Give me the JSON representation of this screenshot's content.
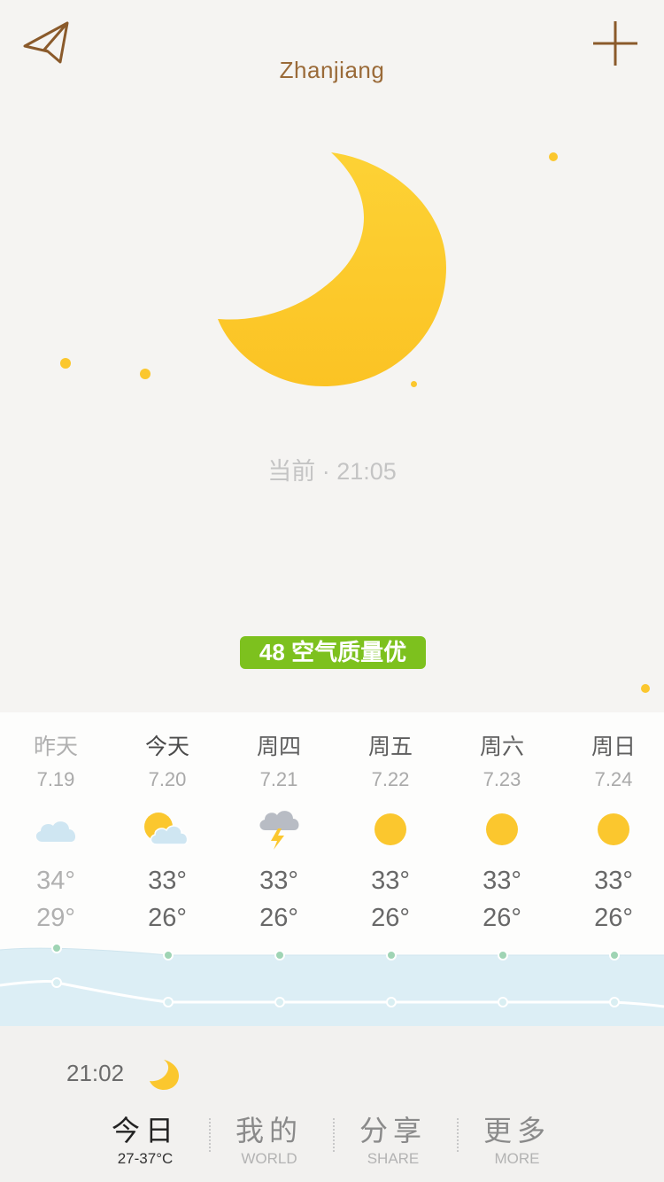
{
  "header": {
    "city": "Zhanjiang",
    "share_icon": "paper-plane-icon",
    "add_icon": "plus-icon"
  },
  "current": {
    "icon": "moon-icon",
    "time_label": "当前 · 21:05"
  },
  "air_quality": {
    "label": "48 空气质量优",
    "color": "#7dc11e"
  },
  "forecast": [
    {
      "day": "昨天",
      "date": "7.19",
      "icon": "cloud-icon",
      "high": "34°",
      "low": "29°"
    },
    {
      "day": "今天",
      "date": "7.20",
      "icon": "partly-cloudy-icon",
      "high": "33°",
      "low": "26°"
    },
    {
      "day": "周四",
      "date": "7.21",
      "icon": "thunderstorm-icon",
      "high": "33°",
      "low": "26°"
    },
    {
      "day": "周五",
      "date": "7.22",
      "icon": "sun-icon",
      "high": "33°",
      "low": "26°"
    },
    {
      "day": "周六",
      "date": "7.23",
      "icon": "sun-icon",
      "high": "33°",
      "low": "26°"
    },
    {
      "day": "周日",
      "date": "7.24",
      "icon": "sun-icon",
      "high": "33°",
      "low": "26°"
    }
  ],
  "bottom": {
    "time": "21:02",
    "icon": "moon-icon",
    "tabs": [
      {
        "cn": "今日",
        "en": "27-37°C"
      },
      {
        "cn": "我的",
        "en": "WORLD"
      },
      {
        "cn": "分享",
        "en": "SHARE"
      },
      {
        "cn": "更多",
        "en": "MORE"
      }
    ]
  },
  "colors": {
    "accent": "#9a6a38",
    "moon": "#fbc72e",
    "aqi_good": "#7dc11e"
  }
}
